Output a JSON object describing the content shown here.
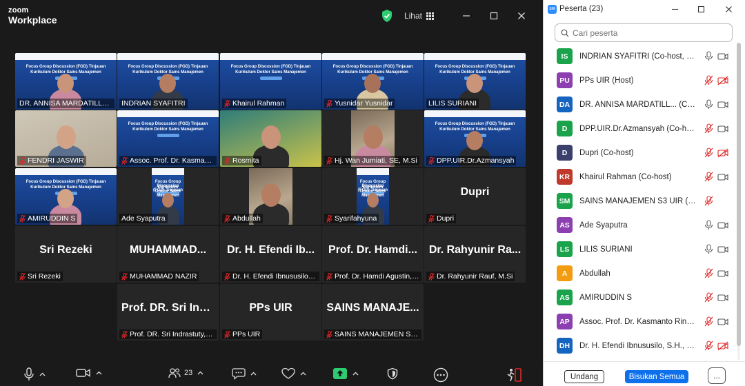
{
  "app": {
    "logo_line1": "zoom",
    "logo_line2": "Workplace",
    "view_label": "Lihat",
    "colors": {
      "background": "#1a1a1a",
      "active_speaker": "#2ecc71",
      "primary": "#0e71eb",
      "muted": "#e02828"
    }
  },
  "slide": {
    "title_line1": "Focus Group Discussion (FGD) Tinjauan",
    "title_line2": "Kurikulum Doktor Sains Manajemen"
  },
  "tiles": [
    {
      "label": "DR. ANNISA MARDATILLAH, ...",
      "kind": "slide-person",
      "muted": false
    },
    {
      "label": "INDRIAN SYAFITRI",
      "kind": "slide-person",
      "muted": false,
      "active": true
    },
    {
      "label": "Khairul Rahman",
      "kind": "slide",
      "muted": true
    },
    {
      "label": "Yusnidar Yusnidar",
      "kind": "slide-person",
      "muted": true
    },
    {
      "label": "LILIS SURIANI",
      "kind": "slide-person",
      "muted": false
    },
    {
      "label": "FENDRI JASWIR",
      "kind": "camera",
      "muted": true
    },
    {
      "label": "Assoc. Prof. Dr. Kasmanto...",
      "kind": "slide",
      "muted": true
    },
    {
      "label": "Rosmita",
      "kind": "camera",
      "muted": true
    },
    {
      "label": "Hj. Wan Jumiati, SE, M.Si",
      "kind": "camera",
      "muted": true
    },
    {
      "label": "DPP.UIR.Dr.Azmansyah",
      "kind": "slide-person",
      "muted": true
    },
    {
      "label": "AMIRUDDIN S",
      "kind": "slide-person",
      "muted": true
    },
    {
      "label": "Ade Syaputra",
      "kind": "narrow-slide",
      "muted": false
    },
    {
      "label": "Abdullah",
      "kind": "camera",
      "muted": true
    },
    {
      "label": "Syarifahyuna",
      "kind": "narrow-slide",
      "muted": true
    },
    {
      "label": "Dupri",
      "kind": "name",
      "big": "Dupri",
      "muted": true
    },
    {
      "label": "Sri Rezeki",
      "kind": "name",
      "big": "Sri Rezeki",
      "muted": true
    },
    {
      "label": "MUHAMMAD NAZIR",
      "kind": "name",
      "big": "MUHAMMAD...",
      "muted": true
    },
    {
      "label": "Dr. H. Efendi Ibnususilo, S...",
      "kind": "name",
      "big": "Dr. H. Efendi Ib...",
      "muted": true
    },
    {
      "label": "Prof. Dr. Hamdi Agustin, ...",
      "kind": "name",
      "big": "Prof. Dr. Hamdi...",
      "muted": true
    },
    {
      "label": "Dr. Rahyunir Rauf, M.Si",
      "kind": "name",
      "big": "Dr. Rahyunir Ra...",
      "muted": true
    },
    {
      "label": "Prof. DR. Sri Indrastuty, S...",
      "kind": "name",
      "big": "Prof. DR. Sri Ind...",
      "muted": true
    },
    {
      "label": "PPs UIR",
      "kind": "name",
      "big": "PPs UIR",
      "muted": true
    },
    {
      "label": "SAINS MANAJEMEN S3 U...",
      "kind": "name",
      "big": "SAINS MANAJE...",
      "muted": true
    }
  ],
  "toolbar": {
    "participant_count": "23"
  },
  "panel": {
    "title": "Peserta (23)",
    "search_placeholder": "Cari peserta",
    "participants": [
      {
        "initials": "IS",
        "color": "#1aa34a",
        "name": "INDRIAN SYAFITRI (Co-host, saya)",
        "mic": "on",
        "cam": "on"
      },
      {
        "initials": "PU",
        "color": "#8b3fb0",
        "name": "PPs UIR (Host)",
        "mic": "off",
        "cam": "off"
      },
      {
        "initials": "DA",
        "color": "#1565c0",
        "name": "DR. ANNISA MARDATILL... (Co-host)",
        "mic": "on",
        "cam": "on"
      },
      {
        "initials": "D",
        "color": "#1aa34a",
        "name": "DPP.UIR.Dr.Azmansyah (Co-host)",
        "mic": "off",
        "cam": "on"
      },
      {
        "initials": "D",
        "color": "#3a3f6b",
        "name": "Dupri (Co-host)",
        "mic": "off",
        "cam": "off"
      },
      {
        "initials": "KR",
        "color": "#c0392b",
        "name": "Khairul Rahman (Co-host)",
        "mic": "off",
        "cam": "on"
      },
      {
        "initials": "SM",
        "color": "#1aa34a",
        "name": "SAINS MANAJEMEN S3 UIR (Co-host)",
        "mic": "off",
        "cam": "none"
      },
      {
        "initials": "AS",
        "color": "#8b3fb0",
        "name": "Ade Syaputra",
        "mic": "on",
        "cam": "on"
      },
      {
        "initials": "LS",
        "color": "#1aa34a",
        "name": "LILIS SURIANI",
        "mic": "on",
        "cam": "on"
      },
      {
        "initials": "A",
        "color": "#f39c12",
        "name": "Abdullah",
        "mic": "off",
        "cam": "on"
      },
      {
        "initials": "AS",
        "color": "#1aa34a",
        "name": "AMIRUDDIN S",
        "mic": "off",
        "cam": "on"
      },
      {
        "initials": "AP",
        "color": "#8b3fb0",
        "name": "Assoc. Prof. Dr. Kasmanto Rinaldi, ...",
        "mic": "off",
        "cam": "on"
      },
      {
        "initials": "DH",
        "color": "#1565c0",
        "name": "Dr. H. Efendi Ibnususilo, S.H., M.H.",
        "mic": "off",
        "cam": "off"
      }
    ],
    "btn_invite": "Undang",
    "btn_mute_all": "Bisukan Semua",
    "btn_more": "..."
  }
}
